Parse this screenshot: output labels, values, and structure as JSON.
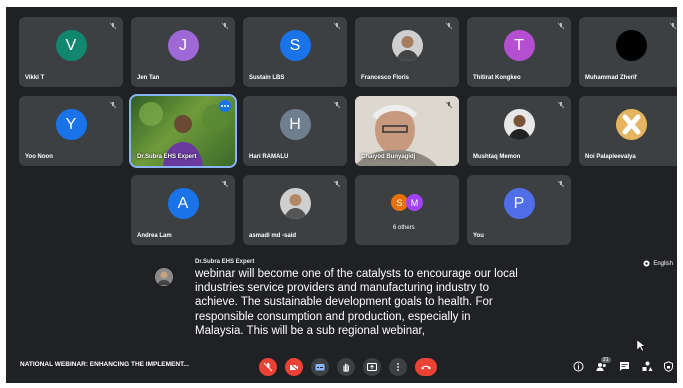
{
  "participants": [
    {
      "name": "Vikki T",
      "initial": "V",
      "color": "#12876f"
    },
    {
      "name": "Jen Tan",
      "initial": "J",
      "color": "#9e69d7"
    },
    {
      "name": "Sustain LBS",
      "initial": "S",
      "color": "#1a73e8"
    },
    {
      "name": "Francesco Floris",
      "initial": "",
      "color": "#777777"
    },
    {
      "name": "Thitirat Kongkeo",
      "initial": "T",
      "color": "#b44fd1"
    },
    {
      "name": "Muhammad Zherif",
      "initial": "",
      "color": "#000000"
    },
    {
      "name": "Yoo Noon",
      "initial": "Y",
      "color": "#1a73e8"
    },
    {
      "name": "Dr.Subra EHS Expert",
      "initial": "",
      "color": "#3a6b2e"
    },
    {
      "name": "Hari RAMALU",
      "initial": "H",
      "color": "#6f7f90"
    },
    {
      "name": "Chaiyod Bunyagidj",
      "initial": "",
      "color": "#d6d0c4"
    },
    {
      "name": "Mushtaq Memon",
      "initial": "",
      "color": "#777777"
    },
    {
      "name": "Noi Palapleevalya",
      "initial": "",
      "color": "#e0b060"
    },
    {
      "name": "Andrea Lam",
      "initial": "A",
      "color": "#1a73e8"
    },
    {
      "name": "asmadi md -said",
      "initial": "",
      "color": "#777777"
    },
    {
      "name": "6 others",
      "initial": "",
      "color": "#3c4043"
    },
    {
      "name": "You",
      "initial": "P",
      "color": "#4f6ee8"
    }
  ],
  "others_initials": [
    "S",
    "M"
  ],
  "caption": {
    "speaker": "Dr.Subra EHS Expert",
    "lines": [
      "webinar will become one of the catalysts to encourage our local",
      "industries service providers and manufacturing industry to",
      "achieve. The sustainable development goals to health. For",
      "responsible consumption and production, especially in",
      "Malaysia. This will be a sub regional webinar,"
    ]
  },
  "language": "English",
  "meeting_title": "NATIONAL WEBINAR: ENHANCING THE IMPLEMENT...",
  "participant_count": "21",
  "colors": {
    "background": "#202124",
    "tile": "#3c4043",
    "danger": "#ea4335"
  }
}
